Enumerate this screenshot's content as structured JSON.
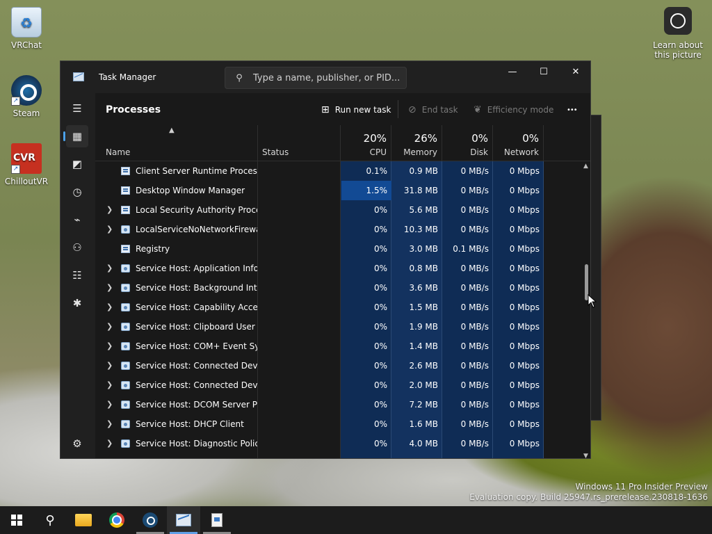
{
  "desktop": {
    "icons": [
      {
        "label": "VRChat"
      },
      {
        "label": "Steam"
      },
      {
        "label": "ChilloutVR"
      }
    ],
    "learn_label": "Learn about this picture",
    "watermark_line1": "Windows 11 Pro Insider Preview",
    "watermark_line2": "Evaluation copy. Build 25947.rs_prerelease.230818-1636"
  },
  "window": {
    "title": "Task Manager",
    "search_placeholder": "Type a name, publisher, or PID...",
    "controls": {
      "minimize": "—",
      "maximize": "☐",
      "close": "✕"
    }
  },
  "toolbar": {
    "page_title": "Processes",
    "run_new_task": "Run new task",
    "end_task": "End task",
    "efficiency_mode": "Efficiency mode",
    "more": "•••"
  },
  "header": {
    "name": "Name",
    "status": "Status",
    "cpu_pct": "20%",
    "cpu": "CPU",
    "memory_pct": "26%",
    "memory": "Memory",
    "disk_pct": "0%",
    "disk": "Disk",
    "network_pct": "0%",
    "network": "Network"
  },
  "processes": [
    {
      "name": "Client Server Runtime Process",
      "cpu": "0.1%",
      "memory": "0.9 MB",
      "disk": "0 MB/s",
      "network": "0 Mbps",
      "expandable": false,
      "icon": "app-icon"
    },
    {
      "name": "Desktop Window Manager",
      "cpu": "1.5%",
      "memory": "31.8 MB",
      "disk": "0 MB/s",
      "network": "0 Mbps",
      "expandable": false,
      "icon": "app-icon",
      "highlight": true
    },
    {
      "name": "Local Security Authority Proce...",
      "cpu": "0%",
      "memory": "5.6 MB",
      "disk": "0 MB/s",
      "network": "0 Mbps",
      "expandable": true,
      "icon": "app-icon"
    },
    {
      "name": "LocalServiceNoNetworkFirewa...",
      "cpu": "0%",
      "memory": "10.3 MB",
      "disk": "0 MB/s",
      "network": "0 Mbps",
      "expandable": true,
      "icon": "service-icon"
    },
    {
      "name": "Registry",
      "cpu": "0%",
      "memory": "3.0 MB",
      "disk": "0.1 MB/s",
      "network": "0 Mbps",
      "expandable": false,
      "icon": "app-icon"
    },
    {
      "name": "Service Host: Application Infor...",
      "cpu": "0%",
      "memory": "0.8 MB",
      "disk": "0 MB/s",
      "network": "0 Mbps",
      "expandable": true,
      "icon": "service-icon"
    },
    {
      "name": "Service Host: Background Inte...",
      "cpu": "0%",
      "memory": "3.6 MB",
      "disk": "0 MB/s",
      "network": "0 Mbps",
      "expandable": true,
      "icon": "service-icon"
    },
    {
      "name": "Service Host: Capability Acces...",
      "cpu": "0%",
      "memory": "1.5 MB",
      "disk": "0 MB/s",
      "network": "0 Mbps",
      "expandable": true,
      "icon": "service-icon"
    },
    {
      "name": "Service Host: Clipboard User S...",
      "cpu": "0%",
      "memory": "1.9 MB",
      "disk": "0 MB/s",
      "network": "0 Mbps",
      "expandable": true,
      "icon": "service-icon"
    },
    {
      "name": "Service Host: COM+ Event Sys...",
      "cpu": "0%",
      "memory": "1.4 MB",
      "disk": "0 MB/s",
      "network": "0 Mbps",
      "expandable": true,
      "icon": "service-icon"
    },
    {
      "name": "Service Host: Connected Devi...",
      "cpu": "0%",
      "memory": "2.6 MB",
      "disk": "0 MB/s",
      "network": "0 Mbps",
      "expandable": true,
      "icon": "service-icon"
    },
    {
      "name": "Service Host: Connected Devi...",
      "cpu": "0%",
      "memory": "2.0 MB",
      "disk": "0 MB/s",
      "network": "0 Mbps",
      "expandable": true,
      "icon": "service-icon"
    },
    {
      "name": "Service Host: DCOM Server Pr...",
      "cpu": "0%",
      "memory": "7.2 MB",
      "disk": "0 MB/s",
      "network": "0 Mbps",
      "expandable": true,
      "icon": "service-icon"
    },
    {
      "name": "Service Host: DHCP Client",
      "cpu": "0%",
      "memory": "1.6 MB",
      "disk": "0 MB/s",
      "network": "0 Mbps",
      "expandable": true,
      "icon": "service-icon"
    },
    {
      "name": "Service Host: Diagnostic Polic...",
      "cpu": "0%",
      "memory": "4.0 MB",
      "disk": "0 MB/s",
      "network": "0 Mbps",
      "expandable": true,
      "icon": "service-icon"
    }
  ],
  "colors": {
    "heat_blue": "#0f2c55",
    "heat_blue_light": "#13325f",
    "highlight": "#124a94",
    "accent": "#4ca0e8"
  }
}
